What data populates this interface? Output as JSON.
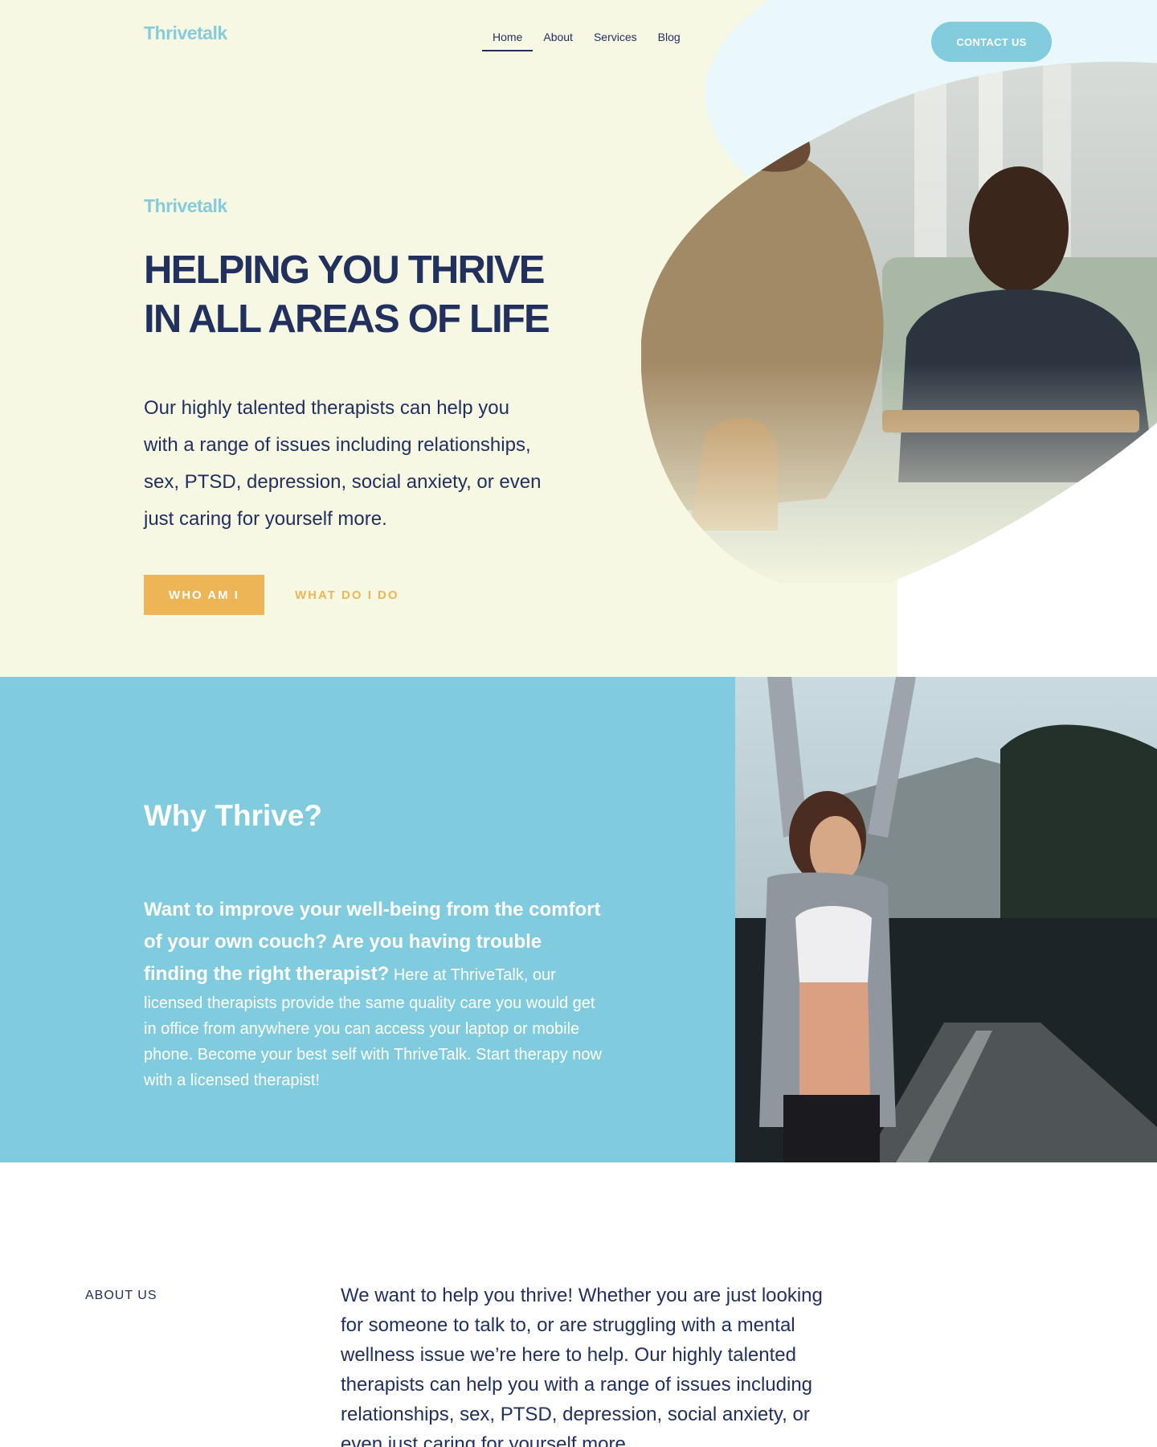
{
  "header": {
    "logo": "Thrivetalk",
    "nav": [
      {
        "label": "Home",
        "active": true
      },
      {
        "label": "About",
        "active": false
      },
      {
        "label": "Services",
        "active": false
      },
      {
        "label": "Blog",
        "active": false
      }
    ],
    "contact_label": "CONTACT US"
  },
  "hero": {
    "eyebrow": "Thrivetalk",
    "headline_line1": "HELPING YOU THRIVE",
    "headline_line2": "IN ALL AREAS OF LIFE",
    "lead": "Our highly talented therapists can help you with a range of issues including relationships, sex, PTSD, depression, social anxiety, or even just caring for yourself more.",
    "primary_button": "WHO AM I",
    "secondary_button": "WHAT DO I DO",
    "image_alt": "therapy-session-photo"
  },
  "why": {
    "title": "Why Thrive?",
    "strong_text": "Want to improve your well-being from the comfort of your own couch? Are you having trouble finding the right therapist?",
    "body_text": "Here at ThriveTalk, our licensed therapists provide the same quality care you would get in office from anywhere you can access your laptop or mobile phone. Become your best self with ThriveTalk.  Start therapy now with a licensed therapist!",
    "image_alt": "woman-stretching-photo"
  },
  "about": {
    "label": "ABOUT US",
    "text": "We want to help you thrive! Whether you are just looking for someone to talk to, or are struggling with a mental wellness issue we’re here to help.  Our highly talented therapists can help you with a range of issues including relationships, sex, PTSD, depression, social anxiety, or even just caring for yourself more."
  },
  "colors": {
    "cream": "#f6f8e3",
    "accent_blue": "#82ccde",
    "navy": "#22305e",
    "gold": "#eeb556",
    "light_blue": "#eaf8fc"
  }
}
